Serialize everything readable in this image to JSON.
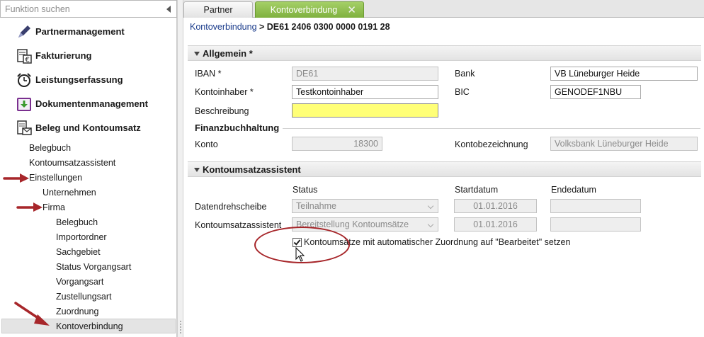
{
  "sidebar": {
    "search_placeholder": "Funktion suchen",
    "modules": [
      {
        "label": "Partnermanagement",
        "icon": "pen-icon"
      },
      {
        "label": "Fakturierung",
        "icon": "invoice-euro-icon"
      },
      {
        "label": "Leistungserfassung",
        "icon": "alarm-clock-icon"
      },
      {
        "label": "Dokumentenmanagement",
        "icon": "download-folder-icon"
      },
      {
        "label": "Beleg und Kontoumsatz",
        "icon": "document-envelope-icon"
      }
    ],
    "tree": {
      "belegbuch": "Belegbuch",
      "kontoumsatzassistent": "Kontoumsatzassistent",
      "einstellungen": "Einstellungen",
      "unternehmen": "Unternehmen",
      "firma": "Firma",
      "firma_items": [
        "Belegbuch",
        "Importordner",
        "Sachgebiet",
        "Status Vorgangsart",
        "Vorgangsart",
        "Zustellungsart",
        "Zuordnung",
        "Kontoverbindung"
      ]
    }
  },
  "tabs": {
    "partner": "Partner",
    "kontoverbindung": "Kontoverbindung",
    "close_glyph": "✕"
  },
  "breadcrumb": {
    "link": "Kontoverbindung",
    "separator": " > ",
    "current": "DE61 2406 0300 0000 0191 28"
  },
  "allgemein": {
    "title": "Allgemein *",
    "iban_label": "IBAN *",
    "iban_value": "DE61",
    "bank_label": "Bank",
    "bank_value": "VB Lüneburger Heide",
    "kontoinhaber_label": "Kontoinhaber *",
    "kontoinhaber_value": "Testkontoinhaber",
    "bic_label": "BIC",
    "bic_value": "GENODEF1NBU",
    "beschreibung_label": "Beschreibung",
    "beschreibung_value": "",
    "fibu_title": "Finanzbuchhaltung",
    "konto_label": "Konto",
    "konto_value": "18300",
    "kontobezeichnung_label": "Kontobezeichnung",
    "kontobezeichnung_value": "Volksbank Lüneburger Heide"
  },
  "assistent": {
    "title": "Kontoumsatzassistent",
    "col_status": "Status",
    "col_start": "Startdatum",
    "col_end": "Endedatum",
    "rows": [
      {
        "label": "Datendrehscheibe",
        "status": "Teilnahme",
        "start": "01.01.2016",
        "end": ""
      },
      {
        "label": "Kontoumsatzassistent",
        "status": "Bereitstellung Kontoumsätze",
        "start": "01.01.2016",
        "end": ""
      }
    ],
    "checkbox_label": "Kontoumsätze mit automatischer Zuordnung auf \"Bearbeitet\" setzen",
    "checkbox_checked": true
  },
  "annotation_color": "#a7262a",
  "accent_green": "#8dbd4c"
}
